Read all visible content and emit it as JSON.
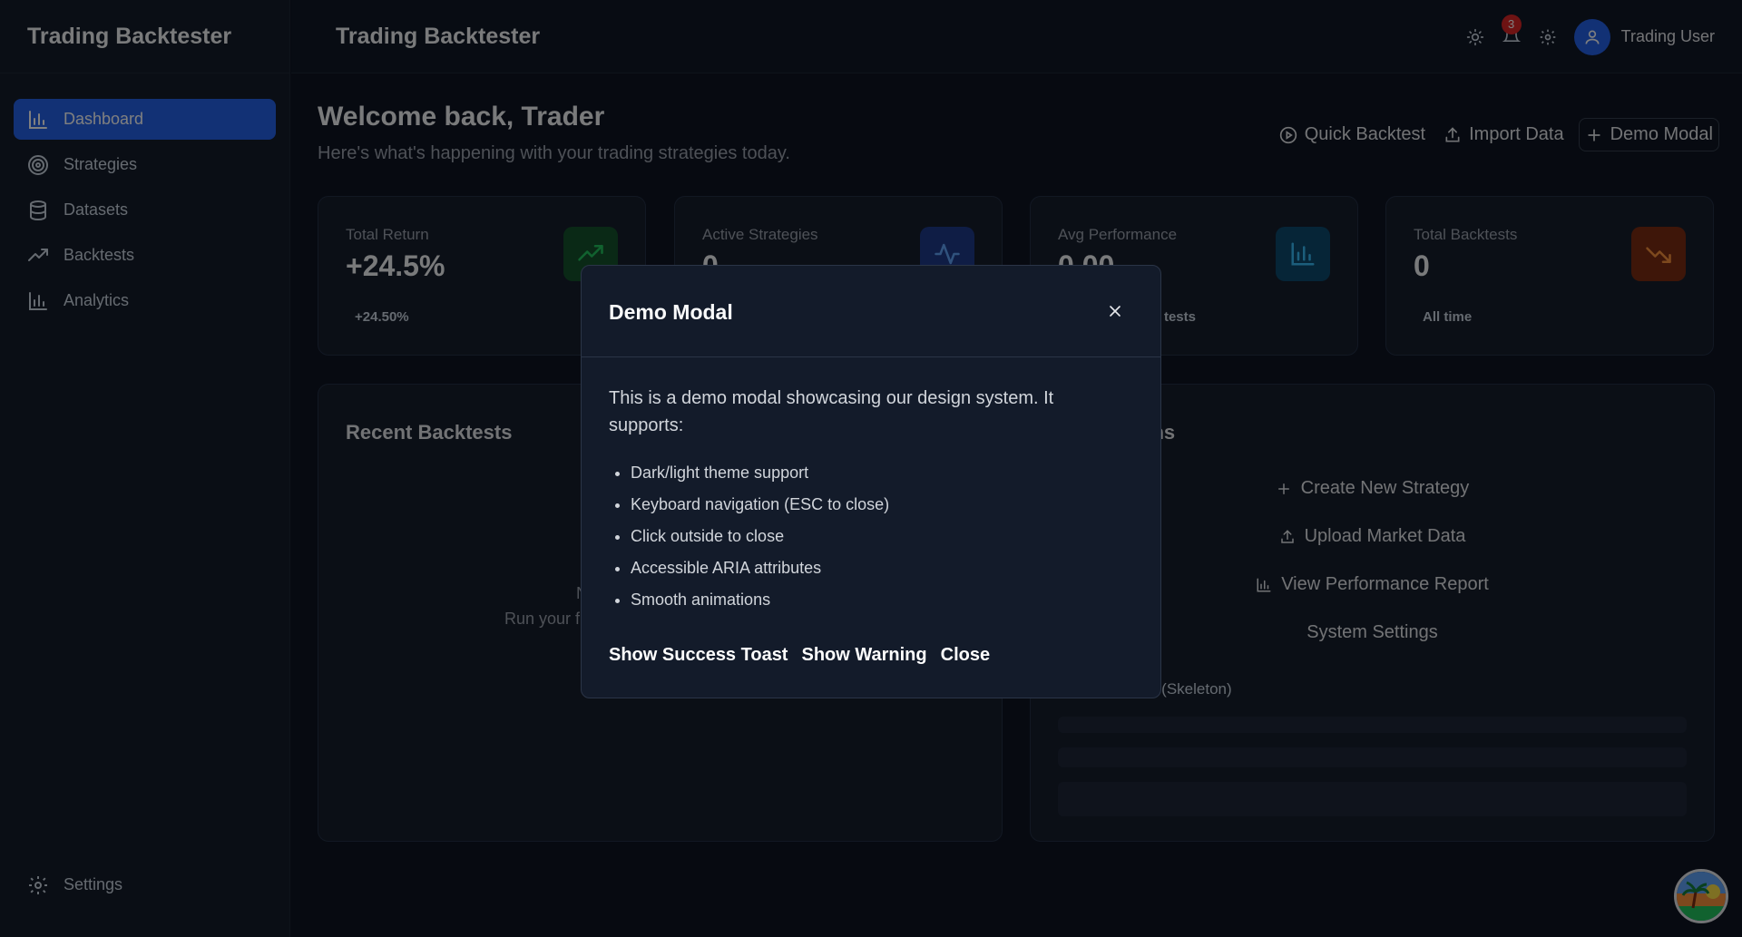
{
  "sidebar": {
    "brand": "Trading Backtester",
    "items": [
      {
        "label": "Dashboard",
        "icon": "bar-chart-icon",
        "active": true
      },
      {
        "label": "Strategies",
        "icon": "target-icon"
      },
      {
        "label": "Datasets",
        "icon": "database-icon"
      },
      {
        "label": "Backtests",
        "icon": "trending-up-icon"
      },
      {
        "label": "Analytics",
        "icon": "bar-chart-icon"
      }
    ],
    "footer": {
      "label": "Settings",
      "icon": "gear-icon"
    }
  },
  "topbar": {
    "title": "Trading Backtester",
    "notification_count": "3",
    "user_name": "Trading User"
  },
  "main": {
    "welcome_title": "Welcome back, Trader",
    "welcome_subtitle": "Here's what's happening with your trading strategies today.",
    "actions": {
      "quick_backtest": "Quick Backtest",
      "import_data": "Import Data",
      "demo_modal": "Demo Modal"
    },
    "stats": [
      {
        "label": "Total Return",
        "value": "+24.5%",
        "sub": "+24.50%",
        "icon": "trending-up-icon",
        "color": "#16a34a"
      },
      {
        "label": "Active Strategies",
        "value": "0",
        "sub": "",
        "icon": "activity-icon",
        "color": "#2563eb"
      },
      {
        "label": "Avg Performance",
        "value": "0.00",
        "sub": "tests",
        "icon": "bar-chart-icon",
        "color": "#0ea5e9"
      },
      {
        "label": "Total Backtests",
        "value": "0",
        "sub": "All time",
        "icon": "trending-down-icon",
        "color": "#ea580c"
      }
    ],
    "recent_backtests": {
      "title": "Recent Backtests",
      "empty_line1": "N",
      "empty_line2": "Run your f"
    },
    "quick_actions": {
      "title": "ons",
      "items": [
        {
          "label": "Create New Strategy",
          "icon": "plus-icon"
        },
        {
          "label": "Upload Market Data",
          "icon": "upload-icon"
        },
        {
          "label": "View Performance Report",
          "icon": "bar-chart-icon"
        },
        {
          "label": "System Settings",
          "icon": ""
        }
      ],
      "skeleton_label": "o (Skeleton)"
    }
  },
  "modal": {
    "title": "Demo Modal",
    "description": "This is a demo modal showcasing our design system. It supports:",
    "features": [
      "Dark/light theme support",
      "Keyboard navigation (ESC to close)",
      "Click outside to close",
      "Accessible ARIA attributes",
      "Smooth animations"
    ],
    "buttons": {
      "success_toast": "Show Success Toast",
      "warning": "Show Warning",
      "close": "Close"
    }
  }
}
